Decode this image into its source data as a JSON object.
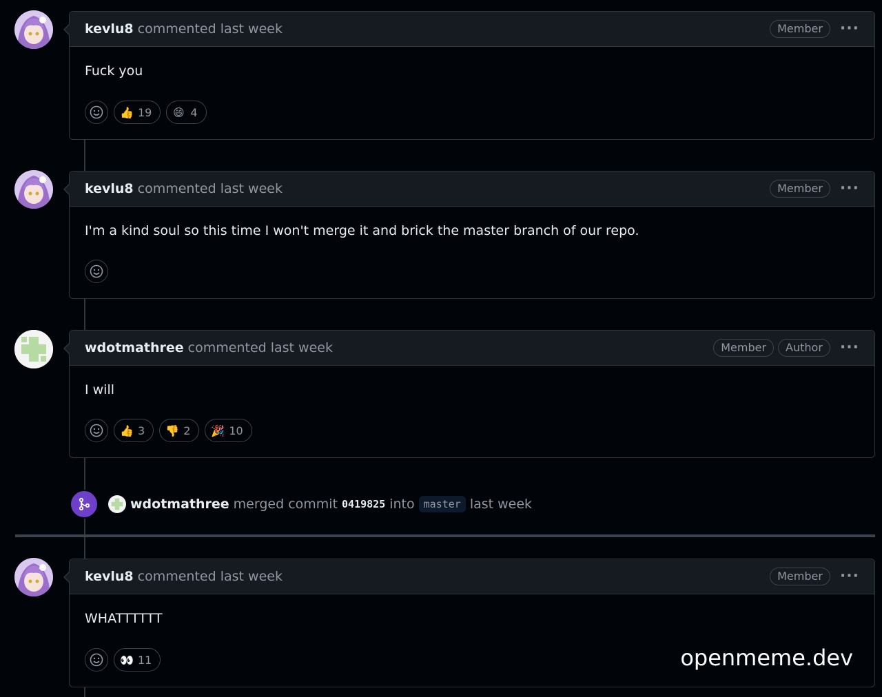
{
  "comments": [
    {
      "author": "kevlu8",
      "meta": "commented last week",
      "badges": [
        "Member"
      ],
      "body": "Fuck you",
      "reactions": [
        {
          "emoji": "👍",
          "count": "19"
        },
        {
          "emoji": "😄",
          "count": "4"
        }
      ]
    },
    {
      "author": "kevlu8",
      "meta": "commented last week",
      "badges": [
        "Member"
      ],
      "body": "I'm a kind soul so this time I won't merge it and brick the master branch of our repo.",
      "reactions": []
    },
    {
      "author": "wdotmathree",
      "meta": "commented last week",
      "badges": [
        "Member",
        "Author"
      ],
      "body": "I will",
      "reactions": [
        {
          "emoji": "👍",
          "count": "3"
        },
        {
          "emoji": "👎",
          "count": "2"
        },
        {
          "emoji": "🎉",
          "count": "10"
        }
      ]
    },
    {
      "author": "kevlu8",
      "meta": "commented last week",
      "badges": [
        "Member"
      ],
      "body": "WHATTTTTT",
      "reactions": [
        {
          "emoji": "👀",
          "count": "11"
        }
      ]
    }
  ],
  "merge_event": {
    "actor": "wdotmathree",
    "text_merged": "merged commit",
    "commit": "0419825",
    "text_into": "into",
    "branch": "master",
    "time": "last week"
  },
  "watermark": "openmeme.dev",
  "colors": {
    "background": "#010409",
    "header": "#161b22",
    "border": "#30363d",
    "merge_purple": "#6e40c9"
  }
}
